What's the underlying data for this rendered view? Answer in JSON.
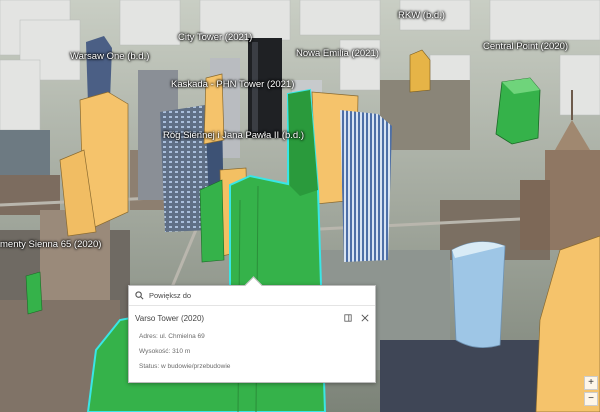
{
  "labels": {
    "rkw": "RKW (b.d.)",
    "city_tower": "City Tower (2021)",
    "warsaw_one": "Warsaw One (b.d.)",
    "nowa_emilia": "Nowa Emilia (2021)",
    "central_point": "Central Point (2020)",
    "kaskada": "Kaskada - PHN Tower (2021)",
    "rog_siennej": "Róg Siennej i Jana Pawła II (b.d.)",
    "sienna65": "menty Sienna 65 (2020)"
  },
  "popup": {
    "zoom_label": "Powiększ do",
    "title": "Varso Tower (2020)",
    "attributes": [
      "Adres: ul. Chmielna 69",
      "Wysokość: 310 m",
      "Status: w budowie/przebudowie"
    ]
  },
  "colors": {
    "completed": "#f5c36b",
    "under_construction": "#35b24a",
    "selected_outline": "#39e6e6",
    "glass": "#9ec6e6"
  },
  "icons": [
    "search-icon",
    "dock-icon",
    "close-icon",
    "plus-icon",
    "minus-icon"
  ]
}
